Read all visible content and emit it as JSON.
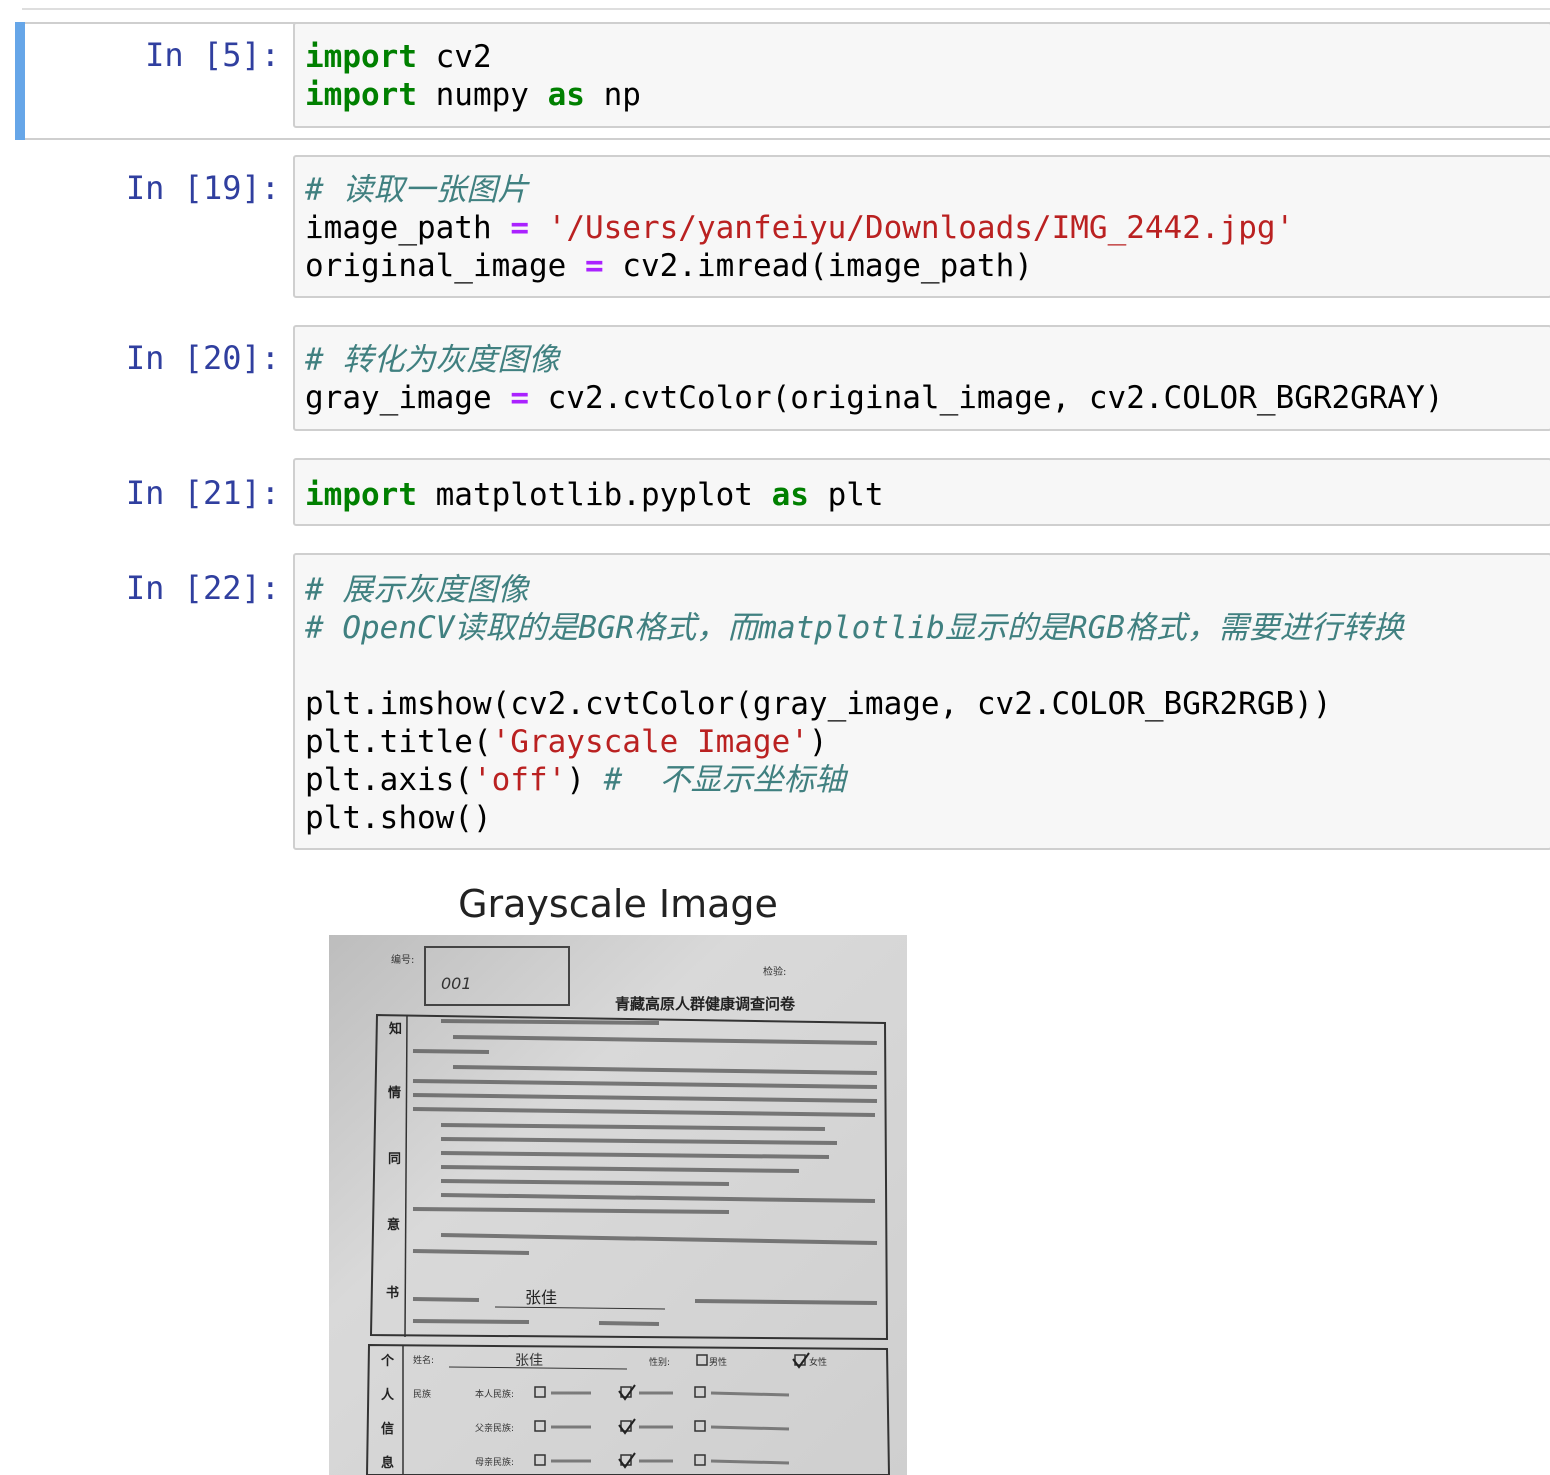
{
  "cells": [
    {
      "prompt": "In [5]:",
      "lines": [
        "import cv2",
        "import numpy as np"
      ]
    },
    {
      "prompt": "In [19]:",
      "lines": [
        "# 读取一张图片",
        "image_path = '/Users/yanfeiyu/Downloads/IMG_2442.jpg'",
        "original_image = cv2.imread(image_path)"
      ]
    },
    {
      "prompt": "In [20]:",
      "lines": [
        "# 转化为灰度图像",
        "gray_image = cv2.cvtColor(original_image, cv2.COLOR_BGR2GRAY)"
      ]
    },
    {
      "prompt": "In [21]:",
      "lines": [
        "import matplotlib.pyplot as plt"
      ]
    },
    {
      "prompt": "In [22]:",
      "lines": [
        "# 展示灰度图像",
        "# OpenCV读取的是BGR格式，而matplotlib显示的是RGB格式，需要进行转换",
        "",
        "plt.imshow(cv2.cvtColor(gray_image, cv2.COLOR_BGR2RGB))",
        "plt.title('Grayscale Image')",
        "plt.axis('off') # 不显示坐标轴",
        "plt.show()"
      ]
    }
  ],
  "output": {
    "title": "Grayscale Image",
    "document": {
      "number_label": "编号:",
      "number_value": "001",
      "top_right_label": "检验:",
      "heading": "青藏高原人群健康调查问卷",
      "side_title": [
        "知",
        "情",
        "同",
        "意",
        "书"
      ],
      "signature_name": "张佳",
      "personal_side": [
        "个",
        "人",
        "信",
        "息"
      ],
      "name_label": "姓名:",
      "name_value": "张佳",
      "gender_label": "性别:",
      "gender_male": "男性",
      "gender_female": "女性",
      "ethnic_label": "民族",
      "row1": "本人民族:",
      "row2": "父亲民族:",
      "row3": "母亲民族:"
    }
  }
}
